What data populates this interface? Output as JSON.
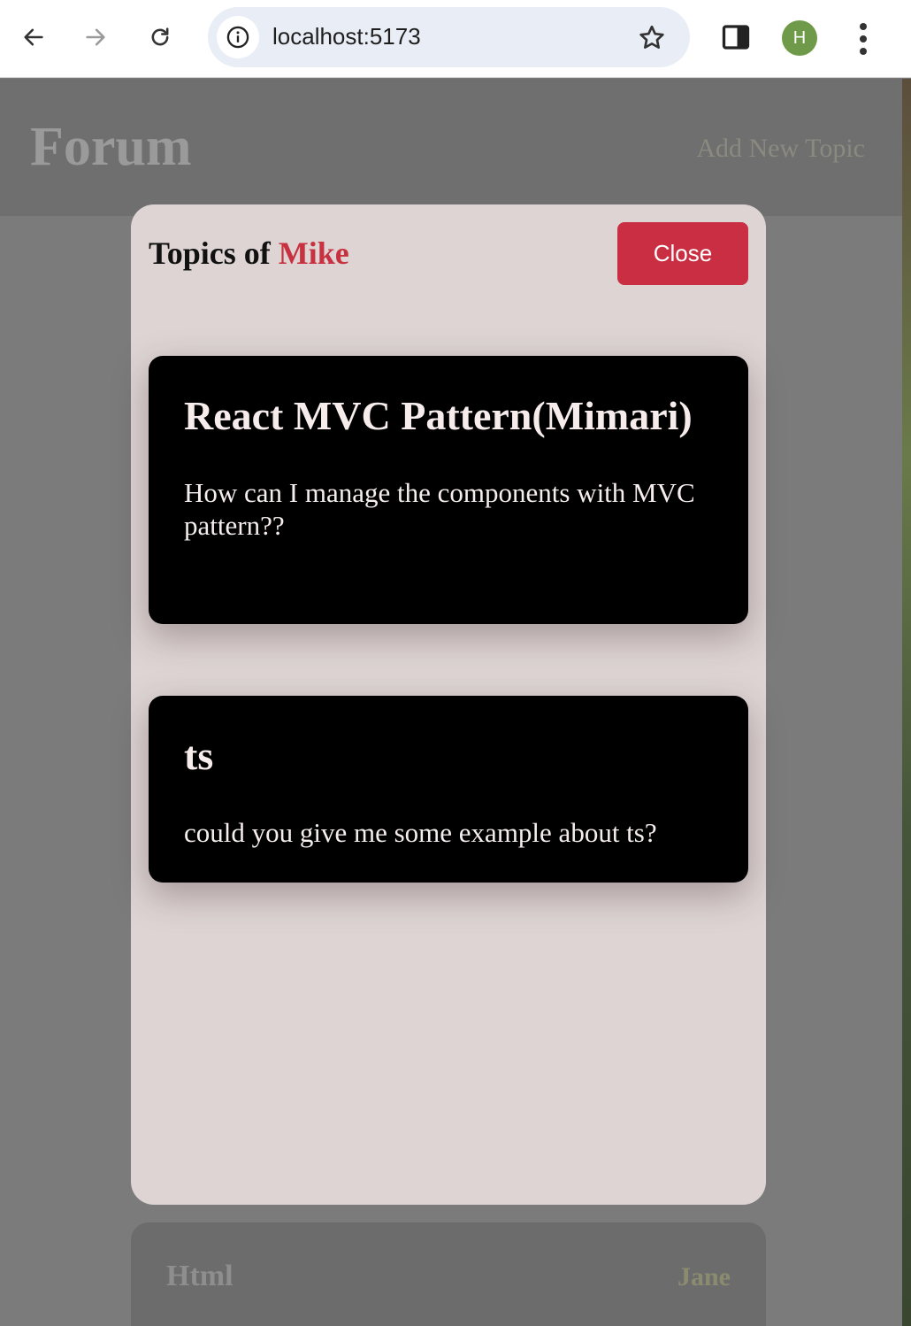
{
  "browser": {
    "url": "localhost:5173",
    "profile_initial": "H",
    "icons": [
      "back-arrow-icon",
      "forward-arrow-icon",
      "reload-icon",
      "site-info-icon",
      "bookmark-star-icon",
      "side-panel-icon",
      "more-menu-icon"
    ]
  },
  "page": {
    "title": "Forum",
    "add_topic_label": "Add New Topic",
    "background_card": {
      "title": "Html",
      "author": "Jane"
    }
  },
  "modal": {
    "title_prefix": "Topics of",
    "author": "Mike",
    "close_label": "Close",
    "topics": [
      {
        "title": "React MVC Pattern(Mimari)",
        "body": "How can I manage the components with MVC pattern??"
      },
      {
        "title": "ts",
        "body": "could you give me some example about ts?"
      }
    ]
  },
  "colors": {
    "accent_red": "#c92e42",
    "modal_bg": "#ded4d4",
    "card_bg": "#000000",
    "avatar_green": "#6e9a49"
  }
}
